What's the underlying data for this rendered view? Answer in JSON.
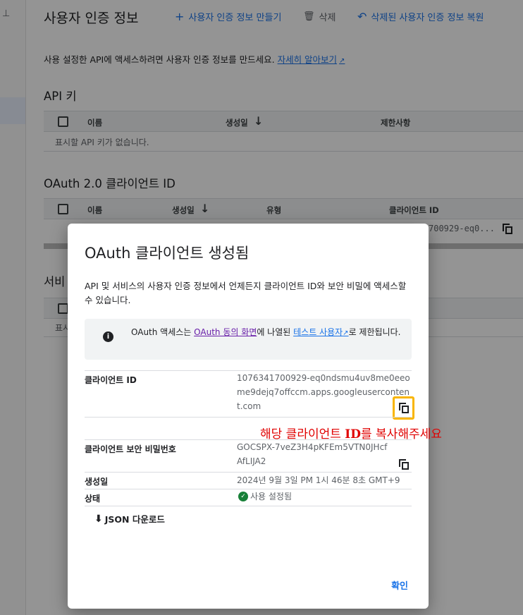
{
  "header": {
    "pin_glyph": "⊥",
    "title": "사용자 인증 정보",
    "actions": [
      {
        "icon": "add-icon",
        "glyph": "+",
        "label": "사용자 인증 정보 만들기"
      },
      {
        "icon": "trash-icon",
        "glyph": "🗑",
        "label": "삭제"
      },
      {
        "icon": "undo-icon",
        "glyph": "↶",
        "label": "삭제된 사용자 인증 정보 복원"
      }
    ]
  },
  "intro": {
    "text": "사용 설정한 API에 액세스하려면 사용자 인증 정보를 만드세요.",
    "link": "자세히 알아보기"
  },
  "api_keys": {
    "title": "API 키",
    "columns": [
      "이름",
      "생성일",
      "제한사항"
    ],
    "sort_glyph": "↓",
    "empty": "표시할 API 키가 없습니다."
  },
  "oauth": {
    "title": "OAuth 2.0 클라이언트 ID",
    "columns": [
      "이름",
      "생성일",
      "유형",
      "클라이언트 ID"
    ],
    "row_id_partial": "700929-eq0..."
  },
  "service_accounts": {
    "title_partial": "서비",
    "row_partial": "표시"
  },
  "dialog": {
    "title": "OAuth 클라이언트 생성됨",
    "description": "API 및 서비스의 사용자 인증 정보에서 언제든지 클라이언트 ID와 보안 비밀에 액세스할 수 있습니다.",
    "info": {
      "icon": "info-icon",
      "glyph": "i",
      "part1": "OAuth 액세스는 ",
      "link1": "OAuth 동의 화면",
      "part2": "에 나열된 ",
      "link2": "테스트 사용자",
      "part3": "로 제한됩니다."
    },
    "fields": {
      "client_id_label": "클라이언트 ID",
      "client_id_value": "1076341700929-eq0ndsmu4uv8me0eeome9dejq7offccm.apps.googleusercontent.com",
      "secret_label": "클라이언트 보안 비밀번호",
      "secret_value": "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",
      "created_label": "생성일",
      "created_value": "2024년 9월 3일 PM 1시 46분 8초 GMT+9",
      "status_label": "상태",
      "status_value": "사용 설정됨",
      "status_glyph": "✓"
    },
    "annotation": {
      "pre": "해당 클라이언트 ",
      "bold": "ID",
      "post": "를 복사해주세요"
    },
    "json_download": "JSON 다운로드",
    "download_glyph": "⬇",
    "ok": "확인"
  },
  "colors": {
    "accent": "#1a73e8",
    "highlight": "#f9b500",
    "annotation": "#e00000",
    "status_ok": "#188038"
  }
}
